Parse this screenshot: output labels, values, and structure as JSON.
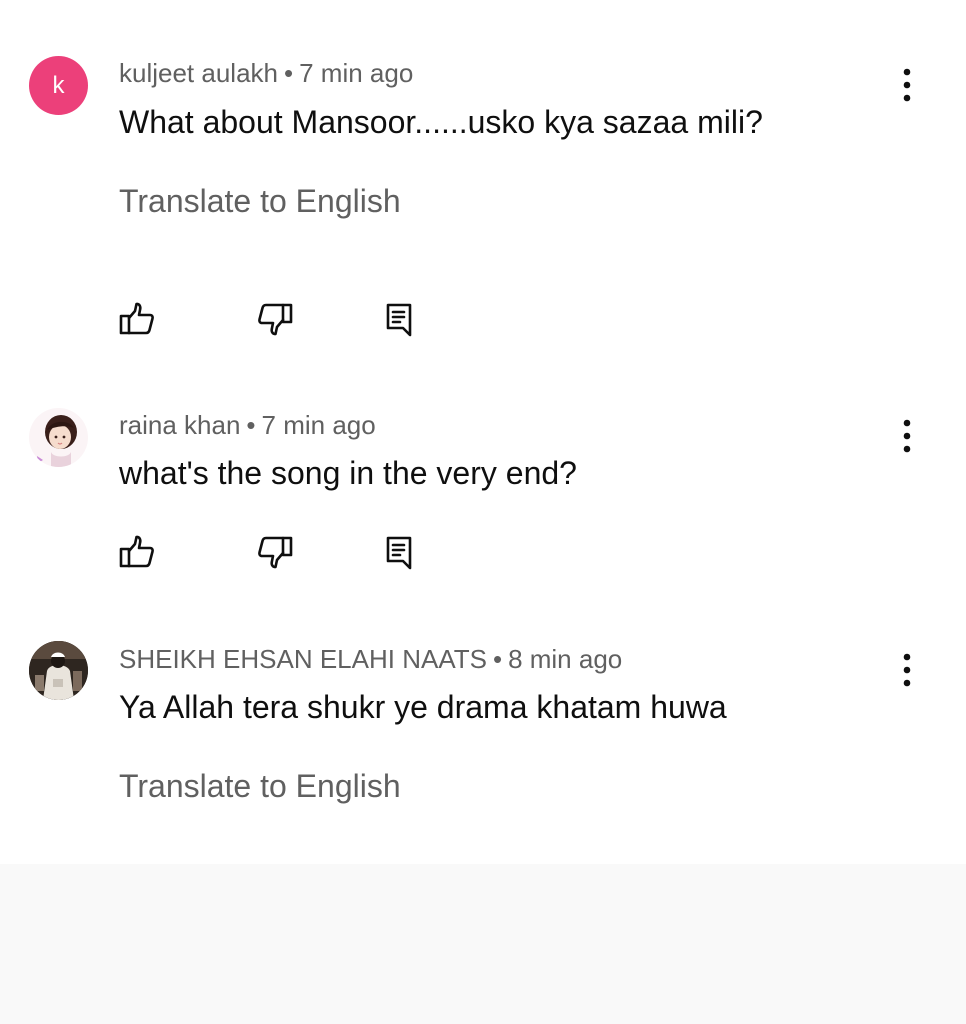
{
  "comments": [
    {
      "author": "kuljeet aulakh",
      "separator": "•",
      "time": "7 min ago",
      "text": "What about Mansoor......usko kya sazaa mili?",
      "translate": "Translate to English",
      "avatar_letter": "k",
      "avatar_color": "#ec407a"
    },
    {
      "author": "raina khan",
      "separator": "•",
      "time": "7 min ago",
      "text": "what's the song in the very end?"
    },
    {
      "author": "SHEIKH EHSAN ELAHI NAATS",
      "separator": "•",
      "time": "8 min ago",
      "text": "Ya Allah tera shukr ye drama khatam huwa",
      "translate": "Translate to English"
    }
  ],
  "icons": {
    "like": "thumb-up-icon",
    "dislike": "thumb-down-icon",
    "reply": "reply-icon",
    "more": "more-vertical-icon"
  },
  "colors": {
    "primary_text": "#0f0f0f",
    "secondary_text": "#606060",
    "footer_bg": "#f9f9f9"
  }
}
